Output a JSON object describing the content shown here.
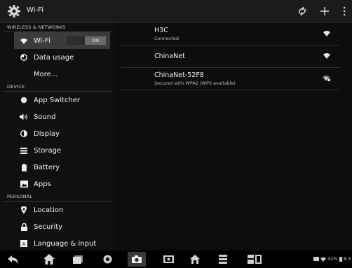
{
  "topbar": {
    "title": "Wi-Fi"
  },
  "sidebar": {
    "sections": [
      {
        "header": "WIRELESS & NETWORKS"
      },
      {
        "header": "DEVICE"
      },
      {
        "header": "PERSONAL"
      }
    ],
    "wifi": {
      "label": "Wi-Fi",
      "toggle": "ON"
    },
    "data_usage": "Data usage",
    "more": "More...",
    "app_switcher": "App Switcher",
    "sound": "Sound",
    "display": "Display",
    "storage": "Storage",
    "battery": "Battery",
    "apps": "Apps",
    "location": "Location",
    "security": "Security",
    "language": "Language & input"
  },
  "networks": [
    {
      "ssid": "H3C",
      "status": "Connected"
    },
    {
      "ssid": "ChinaNet",
      "status": ""
    },
    {
      "ssid": "ChinaNet-52F8",
      "status": "Secured with WPA2 (WPS available)"
    }
  ],
  "tray": {
    "battery": "42%",
    "clock": "8:3"
  }
}
